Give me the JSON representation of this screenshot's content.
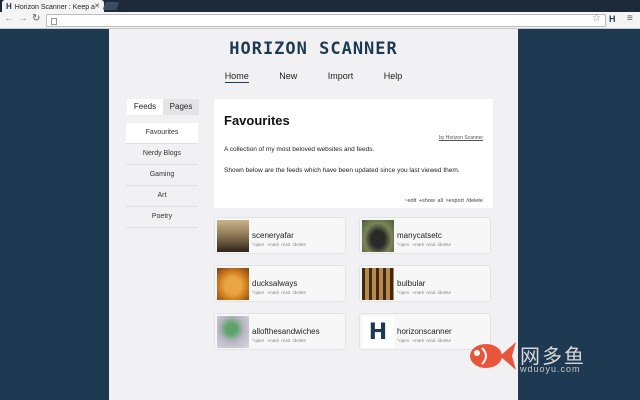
{
  "browser": {
    "tab_title": "Horizon Scanner : Keep a",
    "tab_favicon": "H",
    "extension_label": "H"
  },
  "site": {
    "logo": "HORIZON SCANNER",
    "nav": [
      "Home",
      "New",
      "Import",
      "Help"
    ],
    "active_nav": "Home"
  },
  "sidebar": {
    "tabs": [
      "Feeds",
      "Pages"
    ],
    "active_tab": "Feeds",
    "items": [
      "Favourites",
      "Nerdy Blogs",
      "Gaming",
      "Art",
      "Poetry"
    ],
    "active_item": "Favourites"
  },
  "favourites": {
    "title": "Favourites",
    "byline": "by Horizon Scanner",
    "description": "A collection of my most beloved websites and feeds.",
    "note": "Shown below are the feeds which have been updated since you last viewed them.",
    "actions": "~edit  +show all  >export  /delete"
  },
  "feeds": [
    {
      "name": "sceneryafar",
      "links": "^open ~mark read /delete",
      "thumb": "sunset-photo"
    },
    {
      "name": "manycatsetc",
      "links": "^open ~mark read /delete",
      "thumb": "cat-photo"
    },
    {
      "name": "ducksalways",
      "links": "^open ~mark read /delete",
      "thumb": "duck-photo"
    },
    {
      "name": "bulbular",
      "links": "^open ~mark read /delete",
      "thumb": "bulbs-photo"
    },
    {
      "name": "allofthesandwiches",
      "links": "^open ~mark read /delete",
      "thumb": "sandwich-photo"
    },
    {
      "name": "horizonscanner",
      "links": "^open ~mark read /delete",
      "thumb": "H"
    }
  ],
  "watermark": {
    "chinese": "网多鱼",
    "url": "wduoyu.com"
  },
  "colors": {
    "brand": "#1e3a52",
    "panel": "#f1f1f3",
    "watermark_fish": "#e8553a"
  }
}
